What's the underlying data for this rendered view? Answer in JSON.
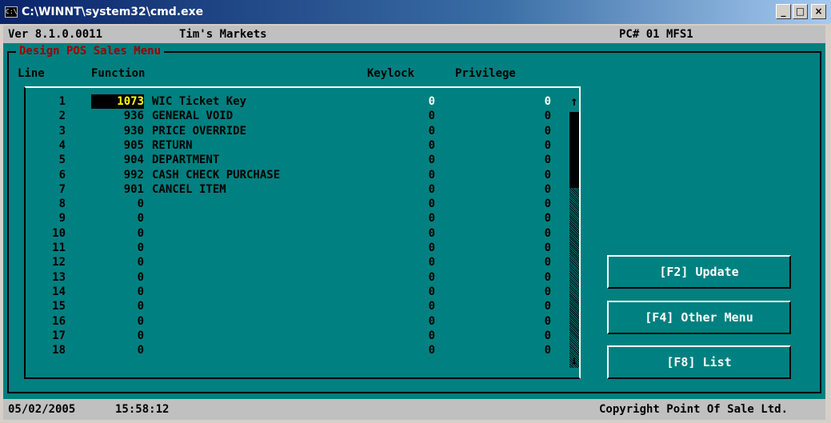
{
  "window": {
    "icon_label": "C:\\",
    "title": "C:\\WINNT\\system32\\cmd.exe",
    "minimize": "_",
    "maximize": "□",
    "close": "×"
  },
  "header": {
    "version": "Ver 8.1.0.0011",
    "store": "Tim's Markets",
    "pc": "PC# 01 MFS1"
  },
  "menu": {
    "title": "Design POS Sales Menu",
    "columns": {
      "line": "Line",
      "function": "Function",
      "keylock": "Keylock",
      "privilege": "Privilege"
    },
    "rows": [
      {
        "line": "1",
        "code": "1073",
        "name": "WIC Ticket Key",
        "keylock": "0",
        "privilege": "0",
        "selected": true
      },
      {
        "line": "2",
        "code": "936",
        "name": "GENERAL VOID",
        "keylock": "0",
        "privilege": "0"
      },
      {
        "line": "3",
        "code": "930",
        "name": "PRICE OVERRIDE",
        "keylock": "0",
        "privilege": "0"
      },
      {
        "line": "4",
        "code": "905",
        "name": "RETURN",
        "keylock": "0",
        "privilege": "0"
      },
      {
        "line": "5",
        "code": "904",
        "name": "DEPARTMENT",
        "keylock": "0",
        "privilege": "0"
      },
      {
        "line": "6",
        "code": "992",
        "name": "CASH CHECK PURCHASE",
        "keylock": "0",
        "privilege": "0"
      },
      {
        "line": "7",
        "code": "901",
        "name": "CANCEL ITEM",
        "keylock": "0",
        "privilege": "0"
      },
      {
        "line": "8",
        "code": "0",
        "name": "",
        "keylock": "0",
        "privilege": "0"
      },
      {
        "line": "9",
        "code": "0",
        "name": "",
        "keylock": "0",
        "privilege": "0"
      },
      {
        "line": "10",
        "code": "0",
        "name": "",
        "keylock": "0",
        "privilege": "0"
      },
      {
        "line": "11",
        "code": "0",
        "name": "",
        "keylock": "0",
        "privilege": "0"
      },
      {
        "line": "12",
        "code": "0",
        "name": "",
        "keylock": "0",
        "privilege": "0"
      },
      {
        "line": "13",
        "code": "0",
        "name": "",
        "keylock": "0",
        "privilege": "0"
      },
      {
        "line": "14",
        "code": "0",
        "name": "",
        "keylock": "0",
        "privilege": "0"
      },
      {
        "line": "15",
        "code": "0",
        "name": "",
        "keylock": "0",
        "privilege": "0"
      },
      {
        "line": "16",
        "code": "0",
        "name": "",
        "keylock": "0",
        "privilege": "0"
      },
      {
        "line": "17",
        "code": "0",
        "name": "",
        "keylock": "0",
        "privilege": "0"
      },
      {
        "line": "18",
        "code": "0",
        "name": "",
        "keylock": "0",
        "privilege": "0"
      }
    ]
  },
  "scrollbar": {
    "up_arrow": "↑",
    "down_arrow": "↓"
  },
  "buttons": {
    "update": "[F2] Update",
    "other_menu": "[F4] Other Menu",
    "list": "[F8] List"
  },
  "footer": {
    "date": "05/02/2005",
    "time": "15:58:12",
    "copyright": "Copyright Point Of Sale Ltd."
  },
  "colors": {
    "background": "#008080",
    "title_text": "#a00000",
    "selection_bg": "#000000",
    "selection_fg": "#ffff00",
    "button_text": "#ffffff"
  }
}
